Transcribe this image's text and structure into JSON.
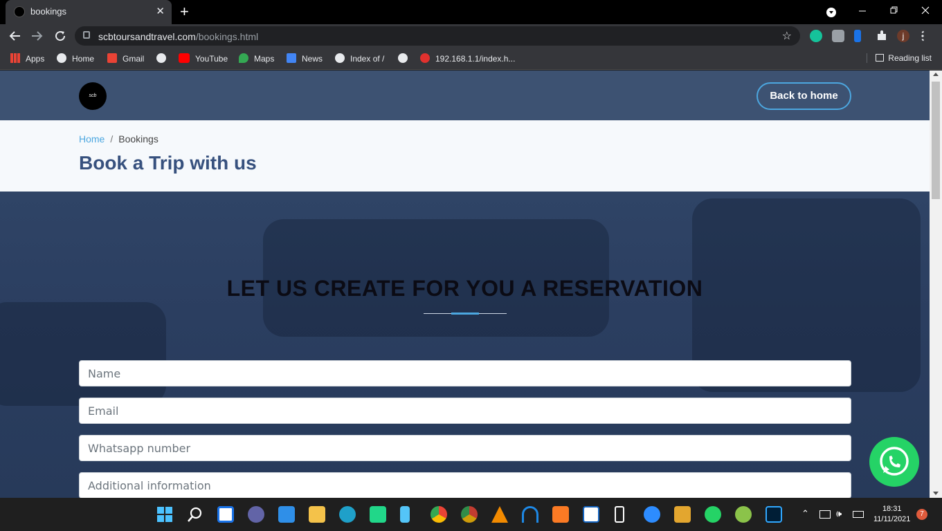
{
  "browser": {
    "tab_title": "bookings",
    "tab_close": "✕",
    "new_tab": "+",
    "url_domain": "scbtoursandtravel.com",
    "url_path": "/bookings.html",
    "profile_initial": "j",
    "bookmarks": [
      "Apps",
      "Home",
      "Gmail",
      "YouTube",
      "Maps",
      "News",
      "Index of /",
      "192.168.1.1/index.h..."
    ],
    "reading_list": "Reading list"
  },
  "site": {
    "logo_text": "scb",
    "back_button": "Back to home",
    "breadcrumb": {
      "home": "Home",
      "separator": "/",
      "current": "Bookings"
    },
    "page_heading": "Book a Trip with us",
    "section_title": "LET US CREATE FOR YOU A RESERVATION",
    "form": {
      "name_placeholder": "Name",
      "email_placeholder": "Email",
      "whatsapp_placeholder": "Whatsapp number",
      "info_placeholder": "Additional information"
    }
  },
  "taskbar": {
    "time": "18:31",
    "date": "11/11/2021",
    "notification_count": "7"
  },
  "colors": {
    "header_bg": "#3d5272",
    "accent": "#4ca7e0",
    "heading": "#37517e",
    "whatsapp": "#25d366"
  }
}
